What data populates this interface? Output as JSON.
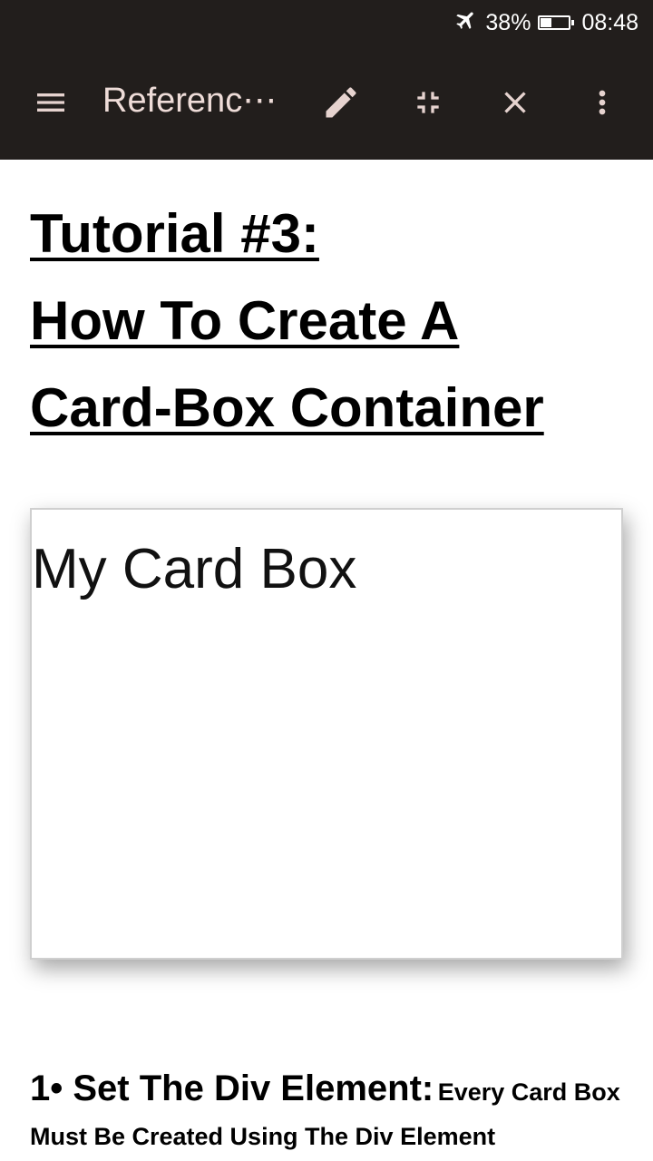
{
  "status_bar": {
    "battery_percent": "38%",
    "battery_level": 0.38,
    "time": "08:48",
    "icons": [
      "airplane-mode-icon",
      "battery-icon"
    ]
  },
  "toolbar": {
    "title": "Referenc⋯",
    "icons": [
      "menu-icon",
      "edit-icon",
      "fullscreen-exit-icon",
      "close-icon",
      "more-vert-icon"
    ]
  },
  "article": {
    "heading_lines": [
      "Tutorial #3:",
      "How To Create A",
      "Card-Box Container"
    ],
    "card_box_text": "My Card Box",
    "step1": {
      "title": "1• Set The Div Element:",
      "text_line1": "Every Card Box",
      "text_line2": "Must Be Created Using The Div Element"
    }
  },
  "colors": {
    "toolbar_bg": "#221e1c",
    "toolbar_icon": "#e6d3cf"
  }
}
